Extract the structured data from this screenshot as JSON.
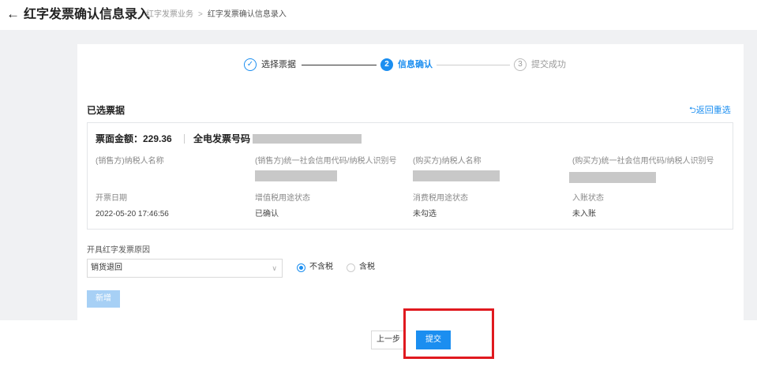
{
  "header": {
    "back_icon": "←",
    "title": "红字发票确认信息录入",
    "breadcrumb": [
      "红字发票业务",
      "红字发票确认信息录入"
    ],
    "separator": ">"
  },
  "steps": [
    {
      "icon": "✓",
      "label": "选择票据",
      "state": "done"
    },
    {
      "icon": "2",
      "label": "信息确认",
      "state": "active"
    },
    {
      "icon": "3",
      "label": "提交成功",
      "state": "pending"
    }
  ],
  "section": {
    "title": "已选票据",
    "reselect": "⮌返回重选"
  },
  "invoice": {
    "amount_label": "票面金额：229.36",
    "invoice_no_label": "全电发票号码",
    "fields": [
      {
        "label": "(销售方)纳税人名称",
        "value": ""
      },
      {
        "label": "(销售方)统一社会信用代码/纳税人识别号",
        "value": ""
      },
      {
        "label": "(购买方)纳税人名称",
        "value": ""
      },
      {
        "label": "(购买方)统一社会信用代码/纳税人识别号",
        "value": ""
      },
      {
        "label": "开票日期",
        "value": "2022-05-20 17:46:56"
      },
      {
        "label": "增值税用途状态",
        "value": "已确认"
      },
      {
        "label": "消费税用途状态",
        "value": "未勾选"
      },
      {
        "label": "入账状态",
        "value": "未入账"
      }
    ]
  },
  "reason": {
    "label": "开具红字发票原因",
    "selected": "销货退回",
    "arrow": "∨"
  },
  "tax_options": [
    {
      "label": "不含税",
      "checked": true
    },
    {
      "label": "含税",
      "checked": false
    }
  ],
  "buttons": {
    "add": "新增",
    "prev": "上一步",
    "submit": "提交"
  },
  "colors": {
    "accent": "#1b8ef0",
    "highlight": "#e0191f"
  }
}
